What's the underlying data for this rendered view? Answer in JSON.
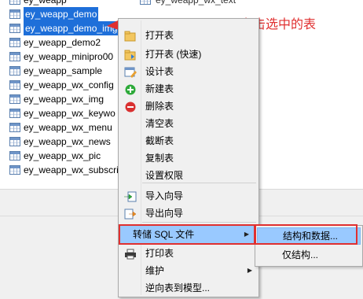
{
  "tree": {
    "items": [
      {
        "label": "ey_weapp",
        "selected": false
      },
      {
        "label": "ey_weapp_demo",
        "selected": true
      },
      {
        "label": "ey_weapp_demo_img",
        "selected": true
      },
      {
        "label": "ey_weapp_demo2",
        "selected": false
      },
      {
        "label": "ey_weapp_minipro00",
        "selected": false
      },
      {
        "label": "ey_weapp_sample",
        "selected": false
      },
      {
        "label": "ey_weapp_wx_config",
        "selected": false
      },
      {
        "label": "ey_weapp_wx_img",
        "selected": false
      },
      {
        "label": "ey_weapp_wx_keywo",
        "selected": false
      },
      {
        "label": "ey_weapp_wx_menu",
        "selected": false
      },
      {
        "label": "ey_weapp_wx_news",
        "selected": false
      },
      {
        "label": "ey_weapp_wx_pic",
        "selected": false
      },
      {
        "label": "ey_weapp_wx_subscri",
        "selected": false
      }
    ],
    "second_column_item": "ey_weapp_wx_text"
  },
  "annotation": {
    "text": "右击选中的表",
    "color": "#e03030"
  },
  "context_menu": {
    "items": [
      {
        "label": "打开表",
        "icon": "open-table-icon"
      },
      {
        "label": "打开表 (快速)",
        "icon": "open-table-fast-icon"
      },
      {
        "label": "设计表",
        "icon": "design-table-icon"
      },
      {
        "label": "新建表",
        "icon": "new-table-icon"
      },
      {
        "label": "删除表",
        "icon": "delete-table-icon"
      },
      {
        "label": "清空表",
        "icon": ""
      },
      {
        "label": "截断表",
        "icon": ""
      },
      {
        "label": "复制表",
        "icon": ""
      },
      {
        "label": "设置权限",
        "icon": ""
      },
      {
        "label": "导入向导",
        "icon": "import-wizard-icon"
      },
      {
        "label": "导出向导",
        "icon": "export-wizard-icon"
      },
      {
        "label": "转储 SQL 文件",
        "icon": "",
        "highlighted": true,
        "has_submenu": true
      },
      {
        "label": "打印表",
        "icon": "print-icon"
      },
      {
        "label": "维护",
        "icon": "",
        "has_submenu": true
      },
      {
        "label": "逆向表到模型...",
        "icon": ""
      }
    ]
  },
  "submenu": {
    "items": [
      {
        "label": "结构和数据...",
        "highlighted": true
      },
      {
        "label": "仅结构..."
      }
    ]
  },
  "colors": {
    "selection": "#1e6fd9",
    "menu_highlight": "#99c9ff",
    "annotation_red": "#e03030"
  }
}
